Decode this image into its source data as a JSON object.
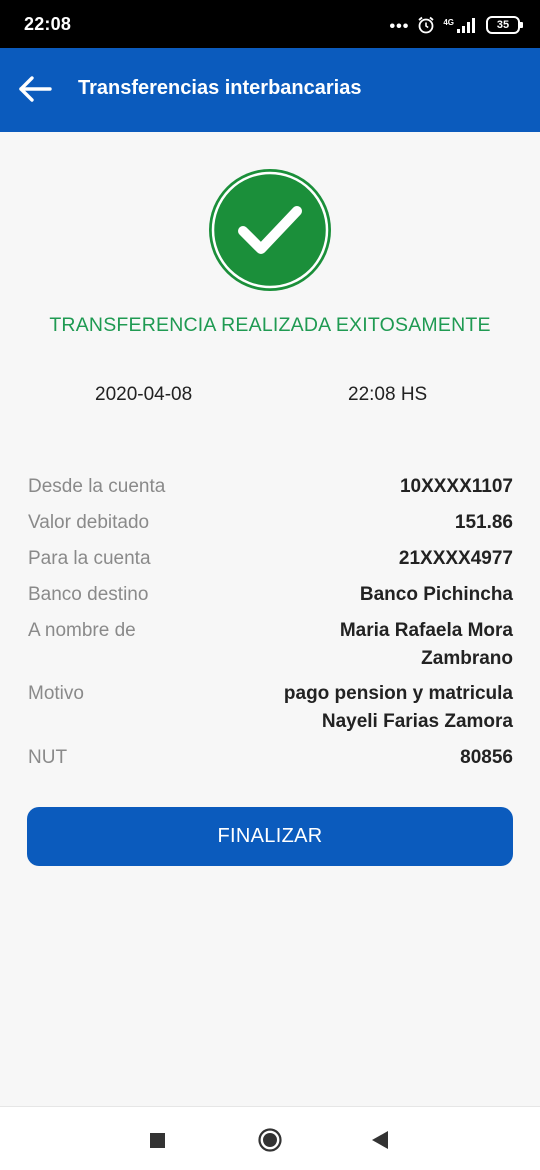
{
  "status_bar": {
    "time": "22:08",
    "dots": "•••",
    "network": "4G",
    "battery": "35"
  },
  "header": {
    "title": "Transferencias interbancarias",
    "back_icon": "arrow-left-icon"
  },
  "result": {
    "icon": "check-circle-icon",
    "message": "TRANSFERENCIA REALIZADA EXITOSAMENTE",
    "date": "2020-04-08",
    "time": "22:08 HS"
  },
  "details": {
    "from_account": {
      "label": "Desde la cuenta",
      "value": "10XXXX1107"
    },
    "amount": {
      "label": "Valor debitado",
      "value": "151.86"
    },
    "to_account": {
      "label": "Para la cuenta",
      "value": "21XXXX4977"
    },
    "bank": {
      "label": "Banco destino",
      "value": "Banco Pichincha"
    },
    "beneficiary": {
      "label": "A nombre de",
      "value": "Maria Rafaela Mora Zambrano"
    },
    "reason": {
      "label": "Motivo",
      "value": "pago pension y matricula Nayeli Farias Zamora"
    },
    "nut": {
      "label": "NUT",
      "value": "80856"
    }
  },
  "actions": {
    "finalize_label": "FINALIZAR"
  },
  "colors": {
    "primary": "#0b5bbd",
    "success": "#1f9a52",
    "success_circle": "#1b8f3a"
  },
  "nav_bar": {
    "recent_icon": "square-icon",
    "home_icon": "circle-home-icon",
    "back_icon": "triangle-back-icon"
  }
}
